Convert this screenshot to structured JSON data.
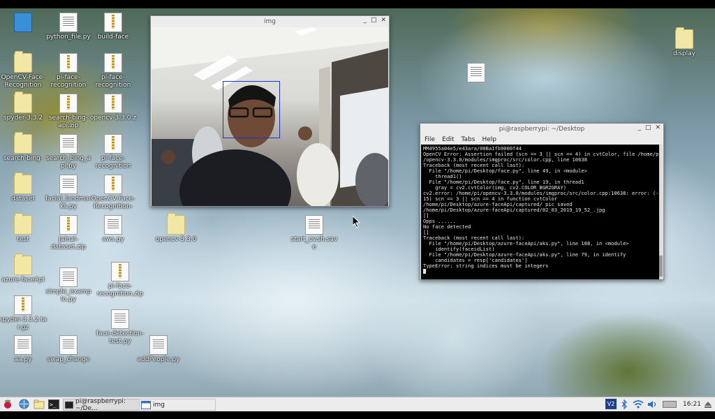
{
  "desktop": {
    "icons": [
      {
        "label": "",
        "kind": "trash",
        "icon": "trash-icon"
      },
      {
        "label": "python_file.py",
        "kind": "file",
        "icon": "text-file-icon"
      },
      {
        "label": "build-face",
        "kind": "zip",
        "icon": "zip-file-icon"
      },
      {
        "label": "OpenCV-Face-\nRecognition",
        "kind": "folder",
        "icon": "folder-icon"
      },
      {
        "label": "pi-face-\nrecognition",
        "kind": "zip",
        "icon": "zip-file-icon"
      },
      {
        "label": "pi-face-\nrecognition",
        "kind": "zip",
        "icon": "zip-file-icon"
      },
      {
        "label": "spyder-3.3.2",
        "kind": "folder",
        "icon": "folder-icon"
      },
      {
        "label": "search-bing-\napi.zip",
        "kind": "zip",
        "icon": "zip-file-icon"
      },
      {
        "label": "opencv-3.3.0.z",
        "kind": "zip",
        "icon": "zip-file-icon"
      },
      {
        "label": "search-bing-",
        "kind": "folder",
        "icon": "folder-icon"
      },
      {
        "label": "search_bing_a\npi.py",
        "kind": "file",
        "icon": "text-file-icon"
      },
      {
        "label": "pi-face-\nrecognition",
        "kind": "zip",
        "icon": "zip-file-icon"
      },
      {
        "label": "dataset",
        "kind": "folder",
        "icon": "folder-icon"
      },
      {
        "label": "facial_landmar\nks.py",
        "kind": "file",
        "icon": "text-file-icon"
      },
      {
        "label": "OpenCV-Face-\nRecognition-",
        "kind": "zip",
        "icon": "zip-file-icon"
      },
      {
        "label": "test",
        "kind": "folder",
        "icon": "folder-icon"
      },
      {
        "label": "jainal-\ndataset.zip",
        "kind": "zip",
        "icon": "zip-file-icon"
      },
      {
        "label": "aws.py",
        "kind": "file",
        "icon": "text-file-icon"
      },
      {
        "label": "opencv-3.3.0",
        "kind": "folder",
        "icon": "folder-icon"
      },
      {
        "label": "start_cv.sh.sav\ne",
        "kind": "file",
        "icon": "text-file-icon"
      },
      {
        "label": "azure-faceApi",
        "kind": "folder",
        "icon": "folder-icon"
      },
      {
        "label": "simple_examp\nle.py",
        "kind": "file",
        "icon": "text-file-icon"
      },
      {
        "label": "pi-face-\nrecognition.zip",
        "kind": "zip",
        "icon": "zip-file-icon"
      },
      {
        "label": "spyder-3.3.2.ta\nr.gz",
        "kind": "zip",
        "icon": "zip-file-icon"
      },
      {
        "label": "face-detection-\ntest.py",
        "kind": "file",
        "icon": "text-file-icon"
      },
      {
        "label": "aa.py",
        "kind": "file",
        "icon": "text-file-icon"
      },
      {
        "label": "swap_change",
        "kind": "file",
        "icon": "text-file-icon"
      },
      {
        "label": "addPeople.py",
        "kind": "file",
        "icon": "text-file-icon"
      },
      {
        "label": "display",
        "kind": "folder",
        "icon": "folder-icon"
      },
      {
        "label": "",
        "kind": "file",
        "icon": "text-file-icon"
      }
    ]
  },
  "img_window": {
    "title": "img",
    "controls": [
      "_",
      "□",
      "✕"
    ],
    "detection_color": "#1f2fd0"
  },
  "terminal": {
    "title": "pi@raspberrypi: ~/Desktop",
    "controls": [
      "_",
      "□",
      "✕"
    ],
    "menu": [
      "File",
      "Edit",
      "Tabs",
      "Help"
    ],
    "lines": [
      "MM4955a04e5/e43ara/00Ba1fb9000f44",
      "OpenCV Error: Assertion failed (scn == 3 || scn == 4) in cvtColor, file /home/pi",
      "/opencv-3.3.0/modules/imgproc/src/color.cpp, line 10638",
      "Traceback (most recent call last):",
      "  File \"/home/pi/Desktop/face.py\", line 49, in <module>",
      "    thread1()",
      "  File \"/home/pi/Desktop/face.py\", line 19, in thread1",
      "    gray = cv2.cvtColor(img, cv2.COLOR_BGR2GRAY)",
      "cv2.error: /home/pi/opencv-3.3.0/modules/imgproc/src/color.cpp:10638: error: (-2",
      "15) scn == 3 || scn == 4 in function cvtColor",
      "",
      "/home/pi/Desktop/azure-faceApi/captured/ pic saved",
      "/home/pi/Desktop/azure-faceApi/captured/02_03_2019_19_52_.jpg",
      "[]",
      "Opps ......",
      "No face detected",
      "[]",
      "Traceback (most recent call last):",
      "  File \"/home/pi/Desktop/azure-faceApi/aks.py\", line 108, in <module>",
      "    identify(faceidList)",
      "  File \"/home/pi/Desktop/azure-faceApi/aks.py\", line 79, in identify",
      "    candidates = resp['candidates']",
      "TypeError: string indices must be integers",
      ""
    ]
  },
  "taskbar": {
    "tasks": [
      {
        "label": "pi@raspberrypi: ~/De...",
        "icon": "terminal-icon"
      },
      {
        "label": "img",
        "icon": "window-icon"
      }
    ],
    "tray": {
      "vnc": "V2",
      "clock": "16:21"
    }
  }
}
